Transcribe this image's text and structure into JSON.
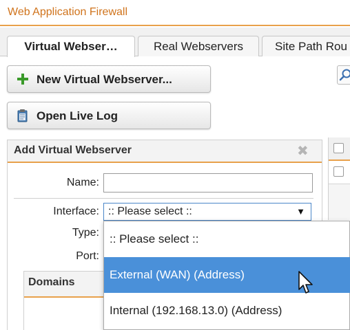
{
  "app": {
    "title": "Web Application Firewall"
  },
  "tabs": [
    {
      "label": "Virtual Webser…",
      "active": true
    },
    {
      "label": "Real Webservers",
      "active": false
    },
    {
      "label": "Site Path Rou",
      "active": false
    }
  ],
  "toolbar": {
    "new_label": "New Virtual Webserver...",
    "log_label": "Open Live Log",
    "search_icon": "search-icon"
  },
  "dialog": {
    "title": "Add Virtual Webserver",
    "name_label": "Name:",
    "name_value": "",
    "interface_label": "Interface:",
    "interface_value": ":: Please select ::",
    "type_label": "Type:",
    "port_label": "Port:",
    "domains_title": "Domains"
  },
  "dropdown": {
    "options": [
      ":: Please select ::",
      "External (WAN) (Address)",
      "Internal (192.168.13.0) (Address)"
    ],
    "highlighted_index": 1
  },
  "colors": {
    "accent": "#d0731b",
    "accent_line": "#e8a04a",
    "selection": "#4a90d9",
    "add_icon": "#3a9a2a"
  }
}
